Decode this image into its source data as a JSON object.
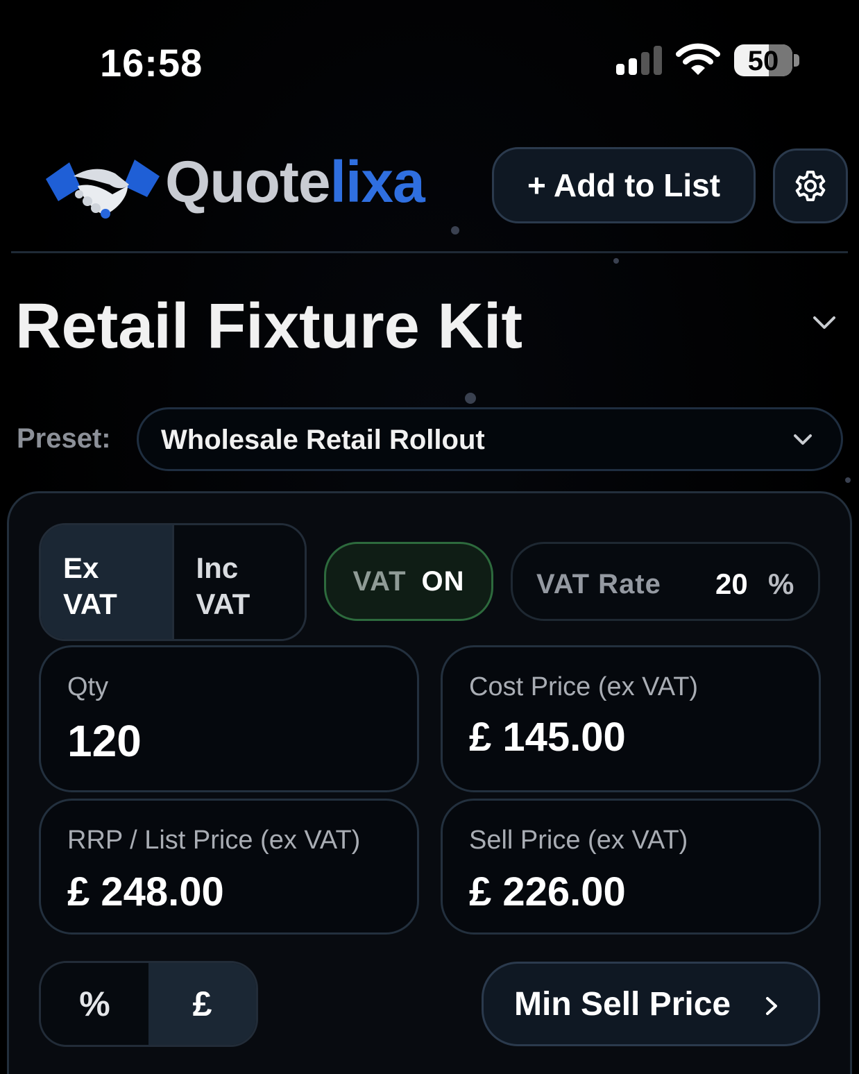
{
  "status_bar": {
    "time": "16:58",
    "battery": "50"
  },
  "header": {
    "logo_text_part1": "Quote",
    "logo_text_part2": "lixa",
    "add_button": "+ Add to List",
    "settings_icon": "gear-icon"
  },
  "title": "Retail Fixture Kit",
  "preset": {
    "label": "Preset:",
    "value": "Wholesale Retail Rollout"
  },
  "vat_mode": {
    "options": [
      {
        "line1": "Ex",
        "line2": "VAT"
      },
      {
        "line1": "Inc",
        "line2": "VAT"
      }
    ],
    "selected": "Ex VAT"
  },
  "vat_toggle": {
    "label": "VAT",
    "state": "ON"
  },
  "vat_rate": {
    "label": "VAT Rate",
    "value": "20",
    "unit": "%"
  },
  "fields": {
    "qty": {
      "label": "Qty",
      "value": "120"
    },
    "cost": {
      "label": "Cost Price (ex VAT)",
      "value": "£ 145.00"
    },
    "rrp": {
      "label": "RRP / List Price (ex VAT)",
      "value": "£ 248.00"
    },
    "sell": {
      "label": "Sell Price (ex VAT)",
      "value": "£ 226.00"
    }
  },
  "unit_toggle": {
    "options": [
      "%",
      "£"
    ],
    "selected": "£"
  },
  "min_sell_button": "Min Sell Price",
  "colors": {
    "accent_blue": "#2f6fe0",
    "vat_on_green": "#2d6a3d",
    "background": "#000000"
  }
}
